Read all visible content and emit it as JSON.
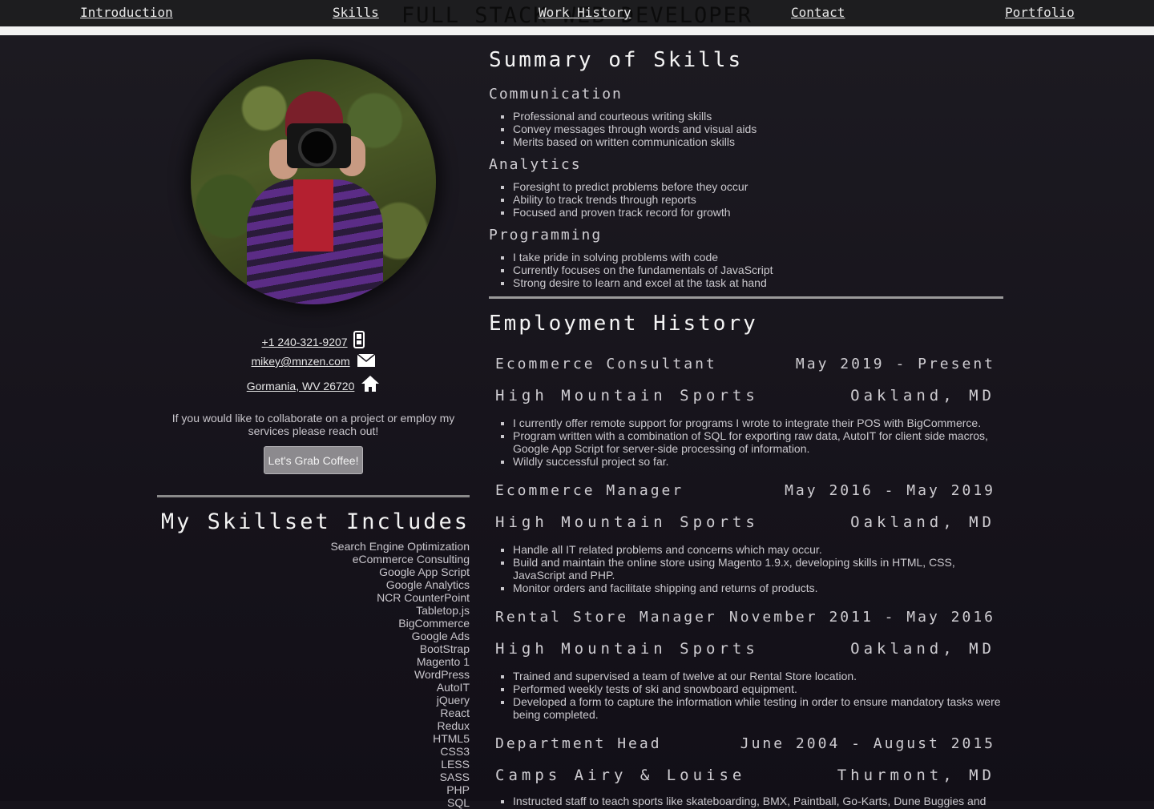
{
  "nav": {
    "title": "FULL STACK WEB DEVELOPER",
    "links": [
      "Introduction",
      "Skills",
      "Work History",
      "Contact",
      "Portfolio"
    ]
  },
  "profile": {
    "phone": "+1 240-321-9207",
    "email": "mikey@mnzen.com",
    "location": "Gormania, WV 26720",
    "collab_text": "If you would like to collaborate on a project or employ my services please reach out!",
    "cta_label": "Let's Grab Coffee!"
  },
  "skillset": {
    "title": "My Skillset Includes",
    "items": [
      "Search Engine Optimization",
      "eCommerce Consulting",
      "Google App Script",
      "Google Analytics",
      "NCR CounterPoint",
      "Tabletop.js",
      "BigCommerce",
      "Google Ads",
      "BootStrap",
      "Magento 1",
      "WordPress",
      "AutoIT",
      "jQuery",
      "React",
      "Redux",
      "HTML5",
      "CSS3",
      "LESS",
      "SASS",
      "PHP",
      "SQL"
    ]
  },
  "summary": {
    "title": "Summary of Skills",
    "groups": [
      {
        "name": "Communication",
        "items": [
          "Professional and courteous writing skills",
          "Convey messages through words and visual aids",
          "Merits based on written communication skills"
        ]
      },
      {
        "name": "Analytics",
        "items": [
          "Foresight to predict problems before they occur",
          "Ability to track trends through reports",
          "Focused and proven track record for growth"
        ]
      },
      {
        "name": "Programming",
        "items": [
          "I take pride in solving problems with code",
          "Currently focuses on the fundamentals of JavaScript",
          "Strong desire to learn and excel at the task at hand"
        ]
      }
    ]
  },
  "employment": {
    "title": "Employment History",
    "jobs": [
      {
        "role": "Ecommerce Consultant",
        "dates": "May 2019 - Present",
        "company": "High Mountain Sports",
        "location": "Oakland, MD",
        "items": [
          "I currently offer remote support for programs I wrote to integrate their POS with BigCommerce.",
          "Program written with a combination of SQL for exporting raw data, AutoIT for client side macros, Google App Script for server-side processing of information.",
          "Wildly successful project so far."
        ]
      },
      {
        "role": "Ecommerce Manager",
        "dates": "May 2016 - May 2019",
        "company": "High Mountain Sports",
        "location": "Oakland, MD",
        "items": [
          "Handle all IT related problems and concerns which may occur.",
          "Build and maintain the online store using Magento 1.9.x, developing  skills in HTML, CSS, JavaScript and PHP.",
          "Monitor orders and facilitate shipping and returns of products."
        ]
      },
      {
        "role": "Rental Store Manager",
        "dates": "November 2011 - May 2016",
        "company": "High Mountain Sports",
        "location": "Oakland, MD",
        "items": [
          "Trained and supervised a team of twelve at our Rental Store location.",
          "Performed weekly tests of ski and snowboard equipment.",
          "Developed a form to capture the information while testing in order to ensure mandatory tasks were being completed."
        ]
      },
      {
        "role": "Department Head",
        "dates": "June 2004 - August 2015",
        "company": "Camps Airy & Louise",
        "location": "Thurmont, MD",
        "items": [
          "Instructed staff to teach sports like skateboarding, BMX, Paintball, Go-Karts, Dune Buggies and"
        ]
      }
    ]
  }
}
